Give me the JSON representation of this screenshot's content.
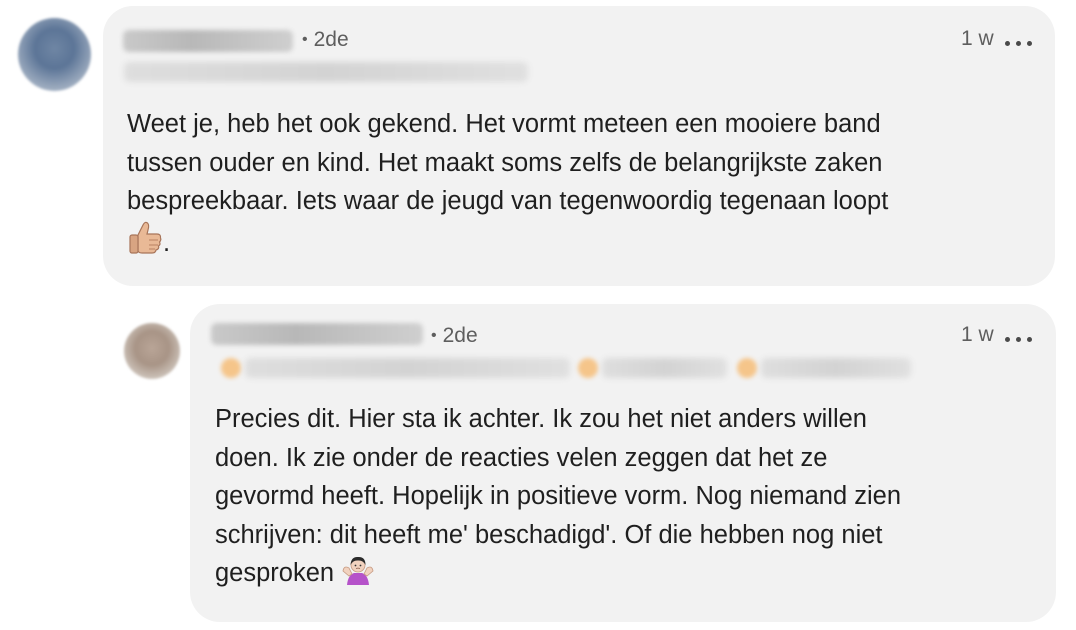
{
  "comments": [
    {
      "connection_degree": "2de",
      "time_ago": "1 w",
      "text": "Weet je, heb het ook gekend. Het vormt meteen een mooiere band\ntussen ouder en kind. Het maakt soms zelfs de belangrijkste zaken\nbespreekbaar. Iets waar de jeugd van tegenwoordig tegenaan loopt",
      "trailing_emoji": "thumbs-up-icon",
      "trailing_punct": "."
    },
    {
      "connection_degree": "2de",
      "time_ago": "1 w",
      "text": "Precies dit. Hier sta ik achter. Ik zou het niet anders willen\ndoen. Ik zie onder de reacties velen zeggen dat het ze\ngevormd heeft. Hopelijk in positieve vorm. Nog niemand zien\nschrijven: dit heeft me' beschadigd'. Of die hebben nog niet\ngesproken",
      "trailing_emoji": "shrug-icon"
    }
  ],
  "colors": {
    "bubble": "#f2f2f2",
    "text": "#1f1f1f",
    "meta": "#5e5e5e"
  }
}
